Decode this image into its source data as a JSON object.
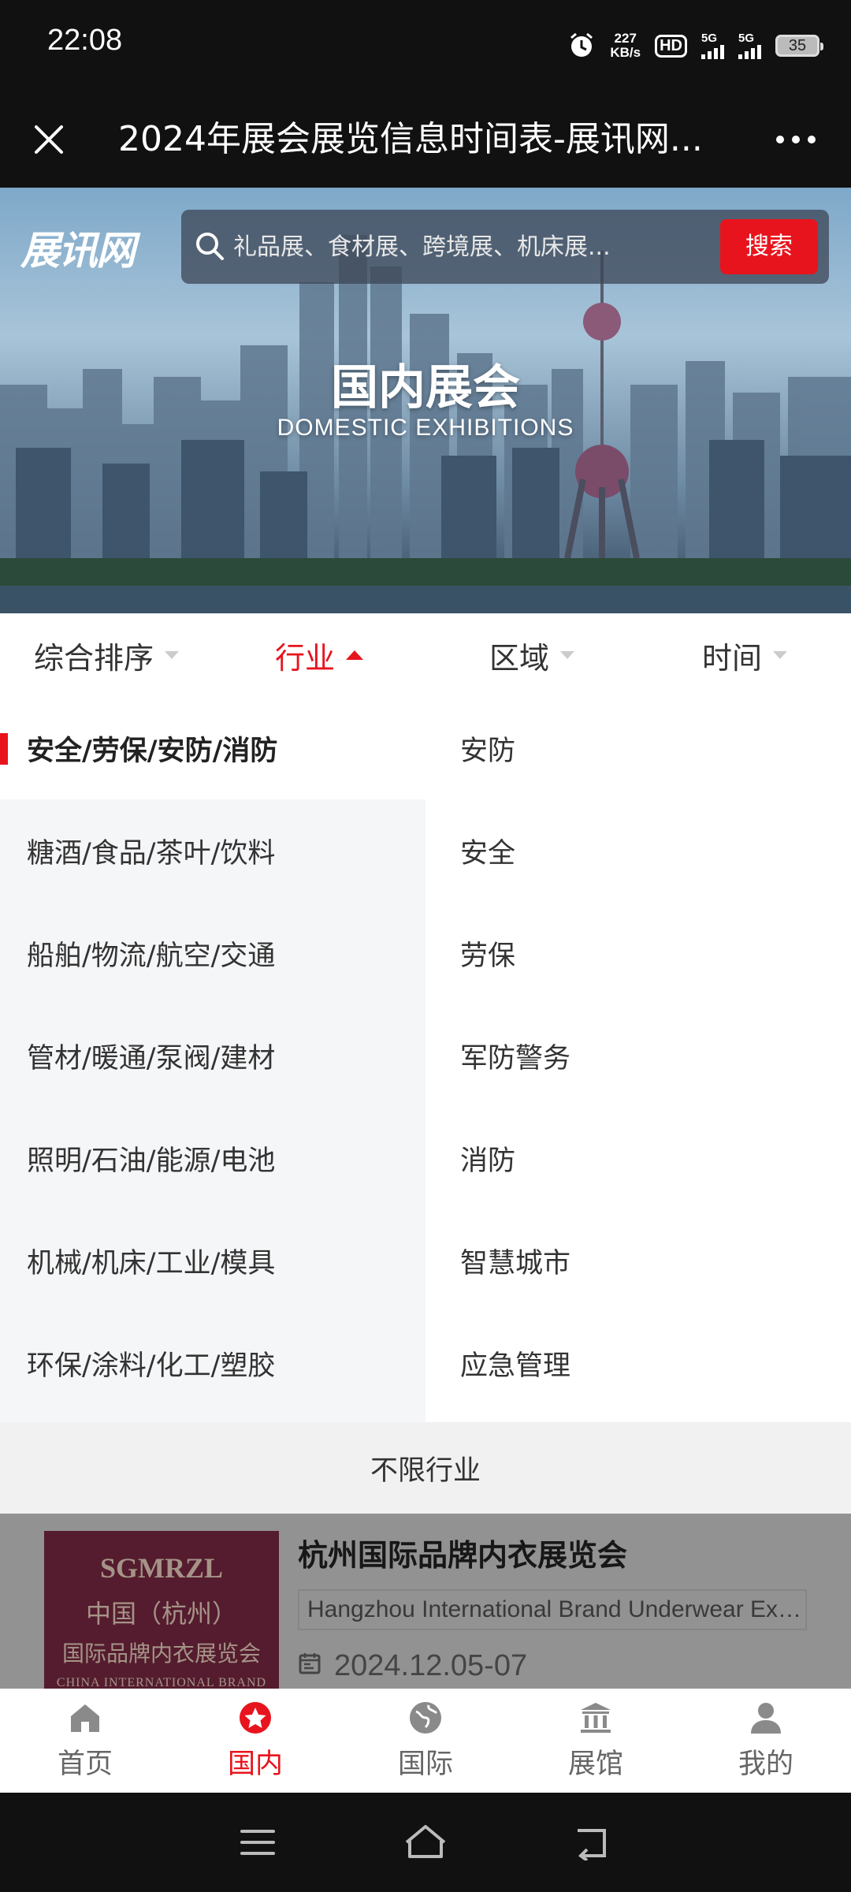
{
  "status_bar": {
    "time": "22:08",
    "net_speed_value": "227",
    "net_speed_unit": "KB/s",
    "hd_label": "HD",
    "signal1_label": "5G",
    "signal2_label": "5G",
    "battery": "35",
    "icons": [
      "alarm-icon",
      "hd-icon",
      "signal-icon",
      "battery-icon"
    ]
  },
  "titlebar": {
    "title": "2024年展会展览信息时间表-展讯网...",
    "icons": [
      "close-icon",
      "more-icon"
    ]
  },
  "hero": {
    "logo": "展讯网",
    "search_placeholder": "礼品展、食材展、跨境展、机床展...",
    "search_button": "搜索",
    "title": "国内展会",
    "subtitle": "DOMESTIC EXHIBITIONS"
  },
  "filters": [
    {
      "label": "综合排序",
      "active": false
    },
    {
      "label": "行业",
      "active": true
    },
    {
      "label": "区域",
      "active": false
    },
    {
      "label": "时间",
      "active": false
    }
  ],
  "categories": [
    "安全/劳保/安防/消防",
    "糖酒/食品/茶叶/饮料",
    "船舶/物流/航空/交通",
    "管材/暖通/泵阀/建材",
    "照明/石油/能源/电池",
    "机械/机床/工业/模具",
    "环保/涂料/化工/塑胶"
  ],
  "selected_category_index": 0,
  "subcategories": [
    "安防",
    "安全",
    "劳保",
    "军防警务",
    "消防",
    "智慧城市",
    "应急管理"
  ],
  "unlimited_label": "不限行业",
  "list_item": {
    "image_text": {
      "line1": "SGMRZL",
      "line2": "中国（杭州）",
      "line3": "国际品牌内衣展览会",
      "line4": "CHINA INTERNATIONAL BRAND"
    },
    "title": "杭州国际品牌内衣展览会",
    "subtitle": "Hangzhou International Brand Underwear Exhibition",
    "date": "2024.12.05-07"
  },
  "bottom_nav": [
    {
      "label": "首页",
      "icon": "home-icon",
      "active": false
    },
    {
      "label": "国内",
      "icon": "star-icon",
      "active": true
    },
    {
      "label": "国际",
      "icon": "globe-icon",
      "active": false
    },
    {
      "label": "展馆",
      "icon": "building-icon",
      "active": false
    },
    {
      "label": "我的",
      "icon": "user-icon",
      "active": false
    }
  ],
  "colors": {
    "accent": "#e8141d",
    "dark_bar": "#111111",
    "category_bg": "#f5f6f8"
  }
}
